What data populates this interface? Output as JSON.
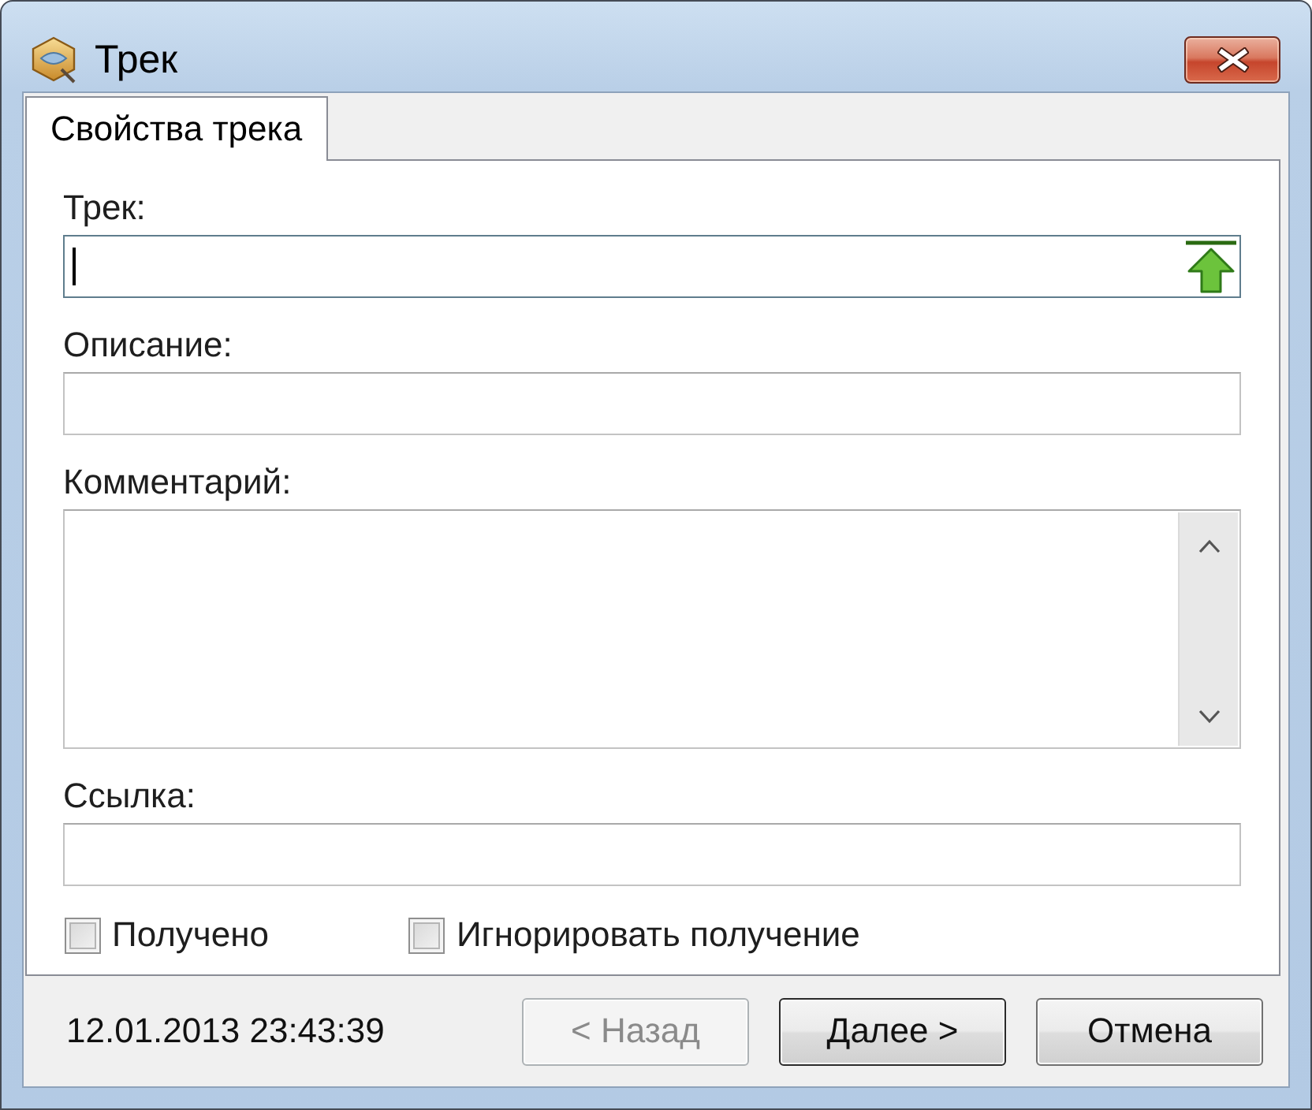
{
  "window": {
    "title": "Трек"
  },
  "tabs": [
    {
      "label": "Свойства трека",
      "selected": true
    }
  ],
  "fields": [
    {
      "kind": "picker",
      "label": "Трек:",
      "focused": true
    },
    {
      "kind": "text",
      "label": "Описание:",
      "focused": false
    },
    {
      "kind": "memo",
      "label": "Комментарий:",
      "focused": false
    },
    {
      "kind": "text",
      "label": "Ссылка:",
      "focused": false
    }
  ],
  "checkboxes": [
    {
      "label": "Получено",
      "checked": false
    },
    {
      "label": "Игнорировать получение",
      "checked": false
    }
  ],
  "timestamp": "12.01.2013 23:43:39",
  "buttons": [
    {
      "label": "< Назад",
      "disabled": true,
      "default": false
    },
    {
      "label": "Далее >",
      "disabled": false,
      "default": true
    },
    {
      "label": "Отмена",
      "disabled": false,
      "default": false
    }
  ]
}
